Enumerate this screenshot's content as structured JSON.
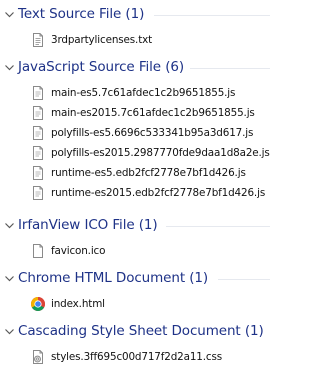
{
  "groups": [
    {
      "title": "Text Source File (1)",
      "items": [
        {
          "name": "3rdpartylicenses.txt",
          "icon": "text-file-icon"
        }
      ]
    },
    {
      "title": "JavaScript Source File (6)",
      "items": [
        {
          "name": "main-es5.7c61afdec1c2b9651855.js",
          "icon": "js-file-icon"
        },
        {
          "name": "main-es2015.7c61afdec1c2b9651855.js",
          "icon": "js-file-icon"
        },
        {
          "name": "polyfills-es5.6696c533341b95a3d617.js",
          "icon": "js-file-icon"
        },
        {
          "name": "polyfills-es2015.2987770fde9daa1d8a2e.js",
          "icon": "js-file-icon"
        },
        {
          "name": "runtime-es5.edb2fcf2778e7bf1d426.js",
          "icon": "js-file-icon"
        },
        {
          "name": "runtime-es2015.edb2fcf2778e7bf1d426.js",
          "icon": "js-file-icon"
        }
      ]
    },
    {
      "title": "IrfanView ICO File (1)",
      "items": [
        {
          "name": "favicon.ico",
          "icon": "ico-file-icon"
        }
      ]
    },
    {
      "title": "Chrome HTML Document (1)",
      "items": [
        {
          "name": "index.html",
          "icon": "chrome-icon"
        }
      ]
    },
    {
      "title": "Cascading Style Sheet Document (1)",
      "items": [
        {
          "name": "styles.3ff695c00d717f2d2a11.css",
          "icon": "css-file-icon"
        }
      ]
    }
  ],
  "colors": {
    "group_title": "#1e3287",
    "group_line": "#e6e9ef",
    "item_text": "#111111",
    "background": "#ffffff"
  }
}
